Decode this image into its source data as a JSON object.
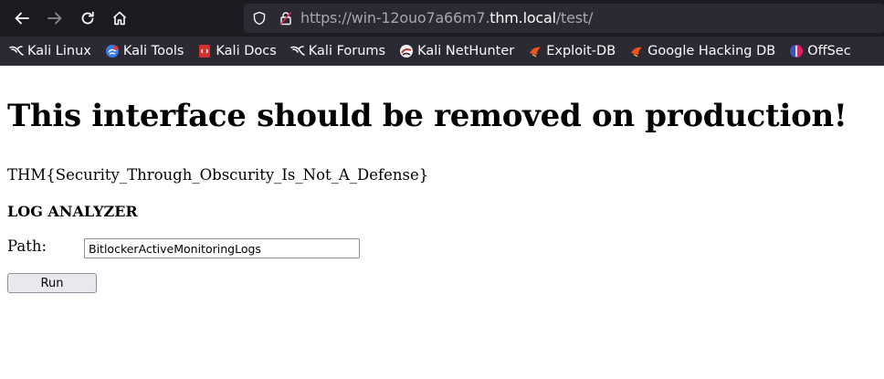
{
  "browser": {
    "url_prefix": "https://win-12ouo7a66m7.",
    "url_domain": "thm.local",
    "url_path": "/test/",
    "bookmarks": [
      {
        "label": "Kali Linux",
        "icon": "kali-dragon-icon"
      },
      {
        "label": "Kali Tools",
        "icon": "kali-tools-icon"
      },
      {
        "label": "Kali Docs",
        "icon": "kali-docs-icon"
      },
      {
        "label": "Kali Forums",
        "icon": "kali-dragon-icon"
      },
      {
        "label": "Kali NetHunter",
        "icon": "nethunter-icon"
      },
      {
        "label": "Exploit-DB",
        "icon": "exploit-db-icon"
      },
      {
        "label": "Google Hacking DB",
        "icon": "exploit-db-icon"
      },
      {
        "label": "OffSec",
        "icon": "offsec-icon"
      }
    ]
  },
  "page": {
    "heading": "This interface should be removed on production!",
    "flag": "THM{Security_Through_Obscurity_Is_Not_A_Defense}",
    "section_title": "LOG ANALYZER",
    "path_label": "Path:",
    "path_value": "BitlockerActiveMonitoringLogs",
    "run_label": "Run"
  },
  "colors": {
    "toolbar_bg": "#1c1b22",
    "urlbar_bg": "#2b2a33",
    "bookmarks_bg": "#2b2a33"
  }
}
